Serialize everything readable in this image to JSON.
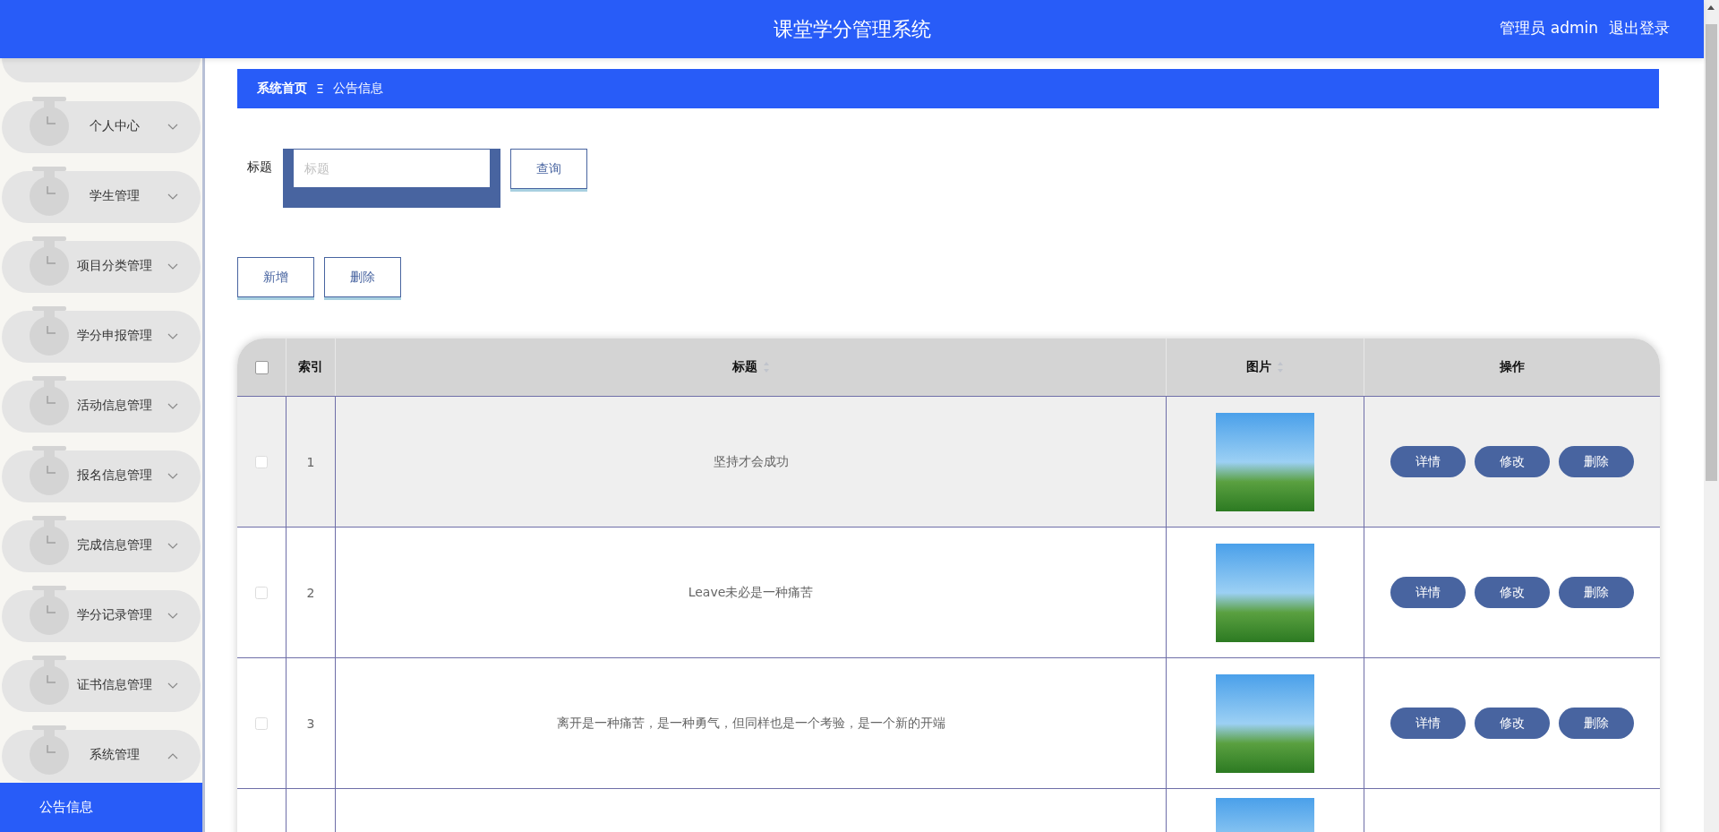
{
  "header": {
    "title": "课堂学分管理系统",
    "user": "管理员 admin",
    "logout": "退出登录"
  },
  "sidebar": {
    "items": [
      {
        "label": "个人中心",
        "expanded": false
      },
      {
        "label": "学生管理",
        "expanded": false
      },
      {
        "label": "项目分类管理",
        "expanded": false
      },
      {
        "label": "学分申报管理",
        "expanded": false
      },
      {
        "label": "活动信息管理",
        "expanded": false
      },
      {
        "label": "报名信息管理",
        "expanded": false
      },
      {
        "label": "完成信息管理",
        "expanded": false
      },
      {
        "label": "学分记录管理",
        "expanded": false
      },
      {
        "label": "证书信息管理",
        "expanded": false
      },
      {
        "label": "系统管理",
        "expanded": true,
        "children": [
          {
            "label": "公告信息",
            "selected": true
          }
        ]
      }
    ]
  },
  "breadcrumb": {
    "home": "系统首页",
    "separator": "Ξ",
    "current": "公告信息"
  },
  "search": {
    "label": "标题",
    "placeholder": "标题",
    "button": "查询"
  },
  "actions": [
    "新增",
    "删除"
  ],
  "table": {
    "select_all_checked": false,
    "columns": [
      {
        "label": "索引",
        "sortable": false
      },
      {
        "label": "标题",
        "sortable": true
      },
      {
        "label": "图片",
        "sortable": true
      },
      {
        "label": "操作",
        "sortable": false
      }
    ],
    "rows": [
      {
        "checked": false,
        "highlighted": true,
        "index": "1",
        "title": "坚持才会成功",
        "buttons": [
          "详情",
          "修改",
          "删除"
        ]
      },
      {
        "checked": false,
        "highlighted": false,
        "index": "2",
        "title": "Leave未必是一种痛苦",
        "buttons": [
          "详情",
          "修改",
          "删除"
        ]
      },
      {
        "checked": false,
        "highlighted": false,
        "index": "3",
        "title": "离开是一种痛苦，是一种勇气，但同样也是一个考验，是一个新的开端",
        "buttons": [
          "详情",
          "修改",
          "删除"
        ]
      }
    ]
  }
}
